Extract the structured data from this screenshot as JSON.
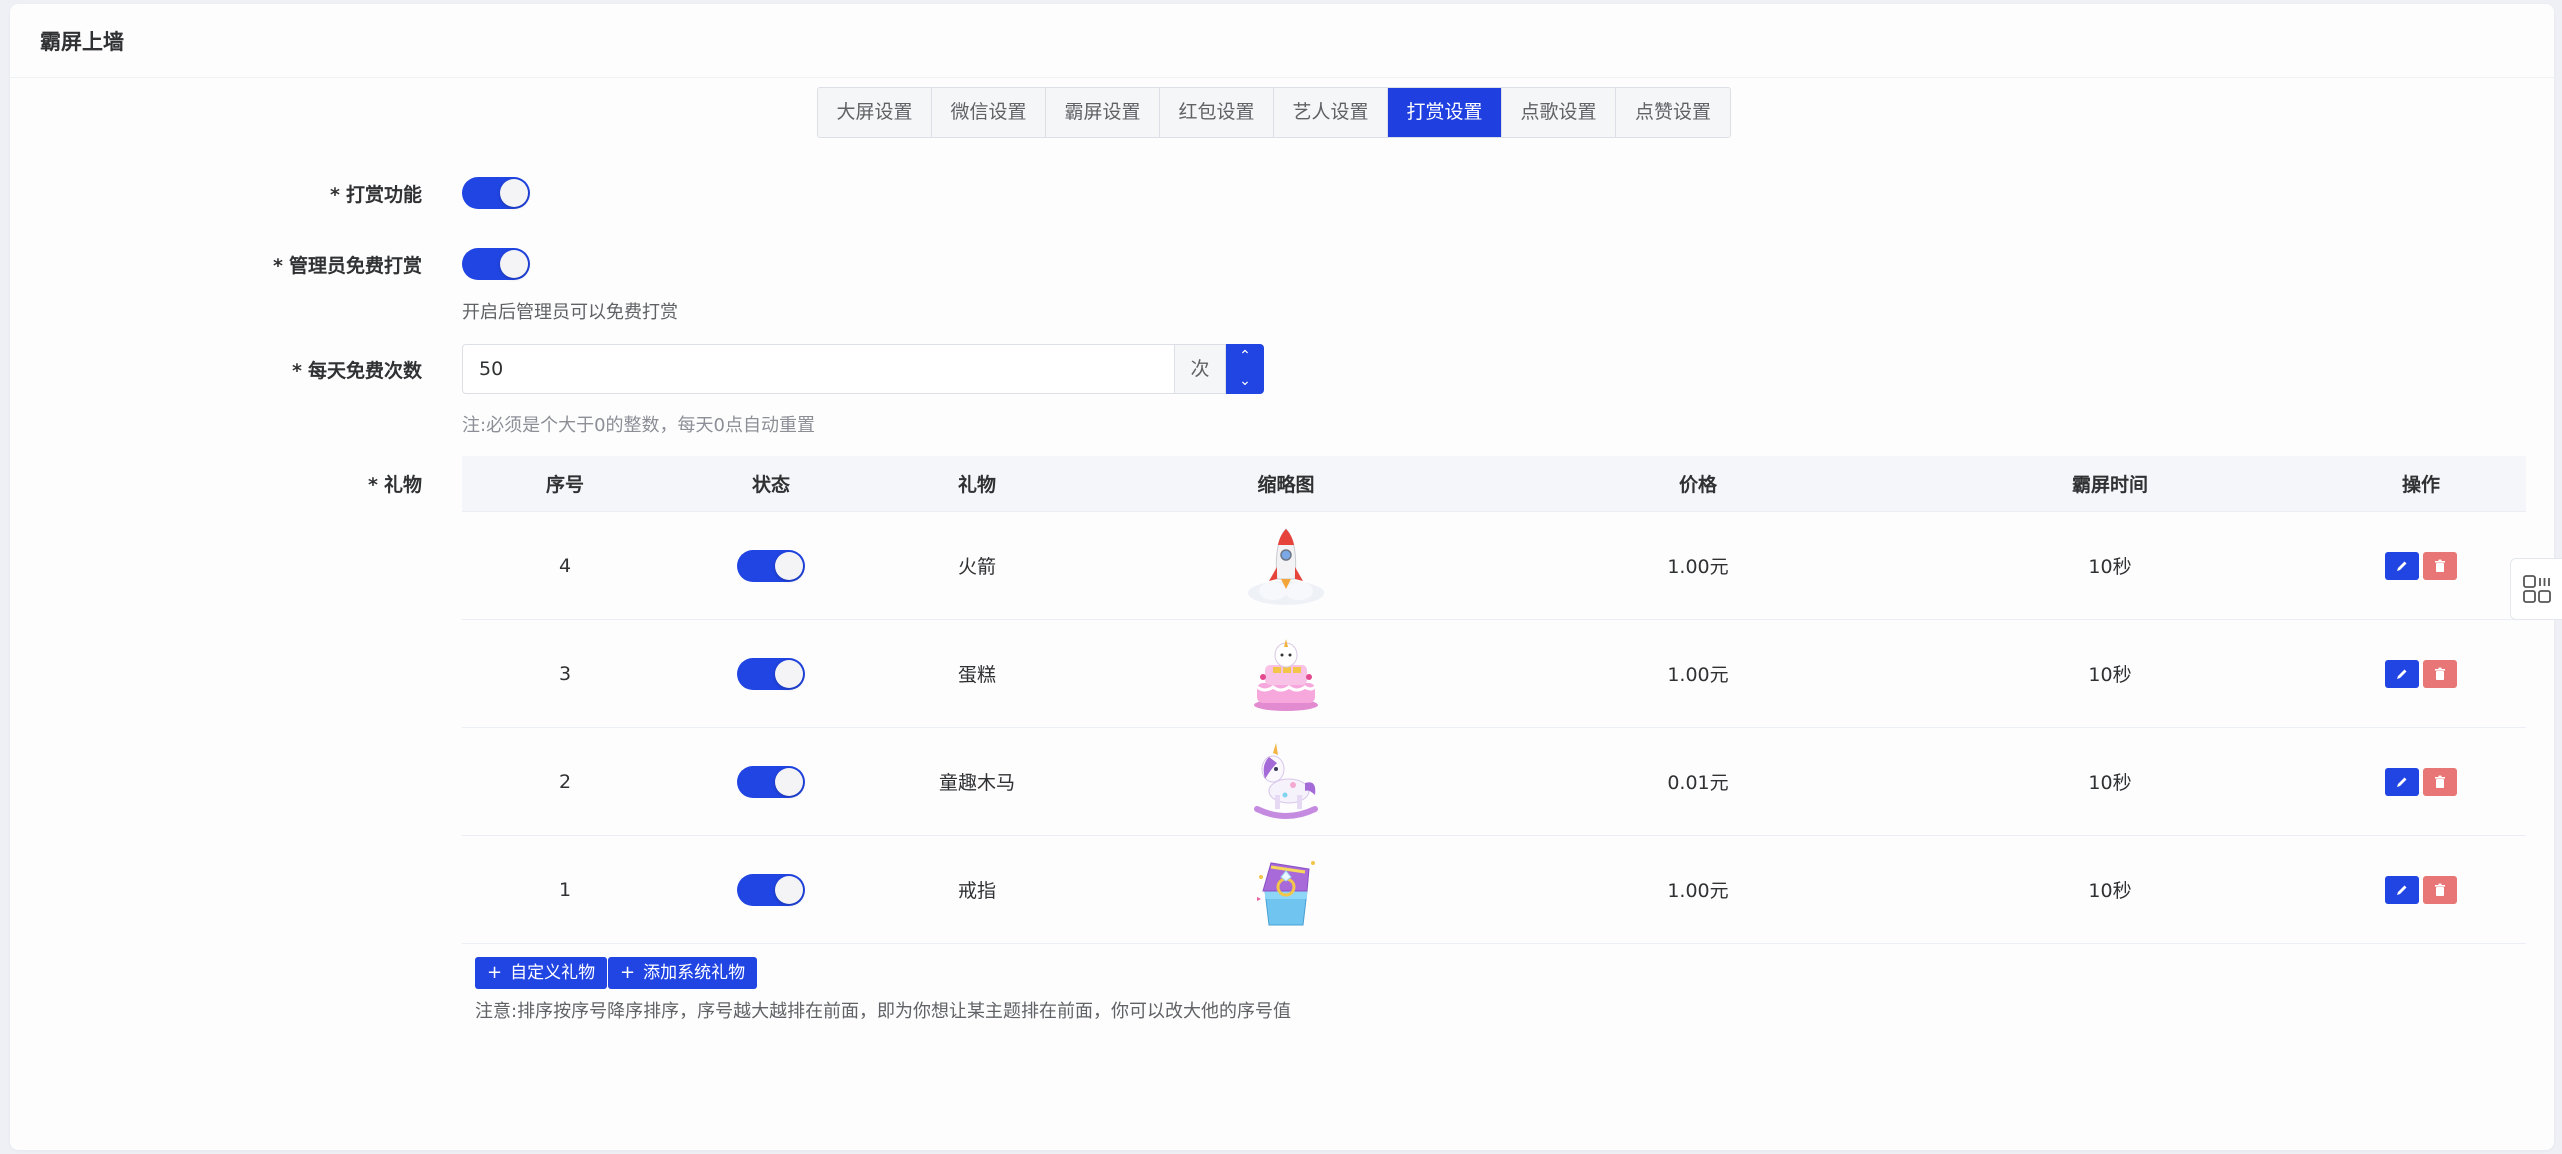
{
  "page": {
    "title": "霸屏上墙"
  },
  "tabs": [
    "大屏设置",
    "微信设置",
    "霸屏设置",
    "红包设置",
    "艺人设置",
    "打赏设置",
    "点歌设置",
    "点赞设置"
  ],
  "active_tab": "打赏设置",
  "form": {
    "reward_label": "打赏功能",
    "admin_free_label": "管理员免费打赏",
    "admin_free_hint": "开启后管理员可以免费打赏",
    "daily_free_label": "每天免费次数",
    "daily_free_value": "50",
    "daily_free_unit": "次",
    "daily_free_note": "注:必须是个大于0的整数，每天0点自动重置",
    "gift_label": "礼物",
    "required_mark": "*"
  },
  "table": {
    "headers": [
      "序号",
      "状态",
      "礼物",
      "缩略图",
      "价格",
      "霸屏时间",
      "操作"
    ],
    "rows": [
      {
        "seq": "4",
        "name": "火箭",
        "price": "1.00元",
        "time": "10秒",
        "icon": "rocket"
      },
      {
        "seq": "3",
        "name": "蛋糕",
        "price": "1.00元",
        "time": "10秒",
        "icon": "cake"
      },
      {
        "seq": "2",
        "name": "童趣木马",
        "price": "0.01元",
        "time": "10秒",
        "icon": "rocking-horse"
      },
      {
        "seq": "1",
        "name": "戒指",
        "price": "1.00元",
        "time": "10秒",
        "icon": "ring-box"
      }
    ]
  },
  "buttons": {
    "custom_gift": "自定义礼物",
    "add_system_gift": "添加系统礼物",
    "plus": "+"
  },
  "footer_note": "注意:排序按序号降序排序，序号越大越排在前面，即为你想让某主题排在前面，你可以改大他的序号值",
  "colors": {
    "primary": "#2145e3",
    "danger": "#e87676"
  }
}
